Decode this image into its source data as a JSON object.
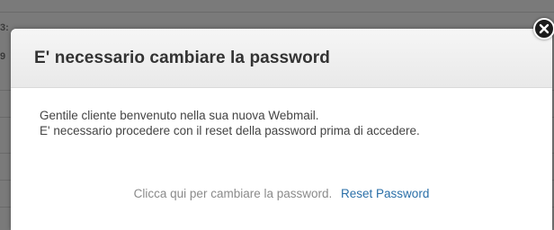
{
  "background": {
    "fragments": [
      "3:",
      "9"
    ]
  },
  "modal": {
    "title": "E' necessario cambiare la password",
    "body_line_1": "Gentile cliente benvenuto nella sua nuova Webmail.",
    "body_line_2": "E' necessario procedere con il reset della password prima di accedere.",
    "footer_text": "Clicca qui per cambiare la password.",
    "reset_link": "Reset Password"
  },
  "icons": {
    "close": "close-icon"
  },
  "colors": {
    "overlay": "#7a7a7a",
    "link": "#2a6fa8",
    "title": "#333333",
    "body_text": "#444444",
    "footer_text": "#8a8a8a"
  }
}
